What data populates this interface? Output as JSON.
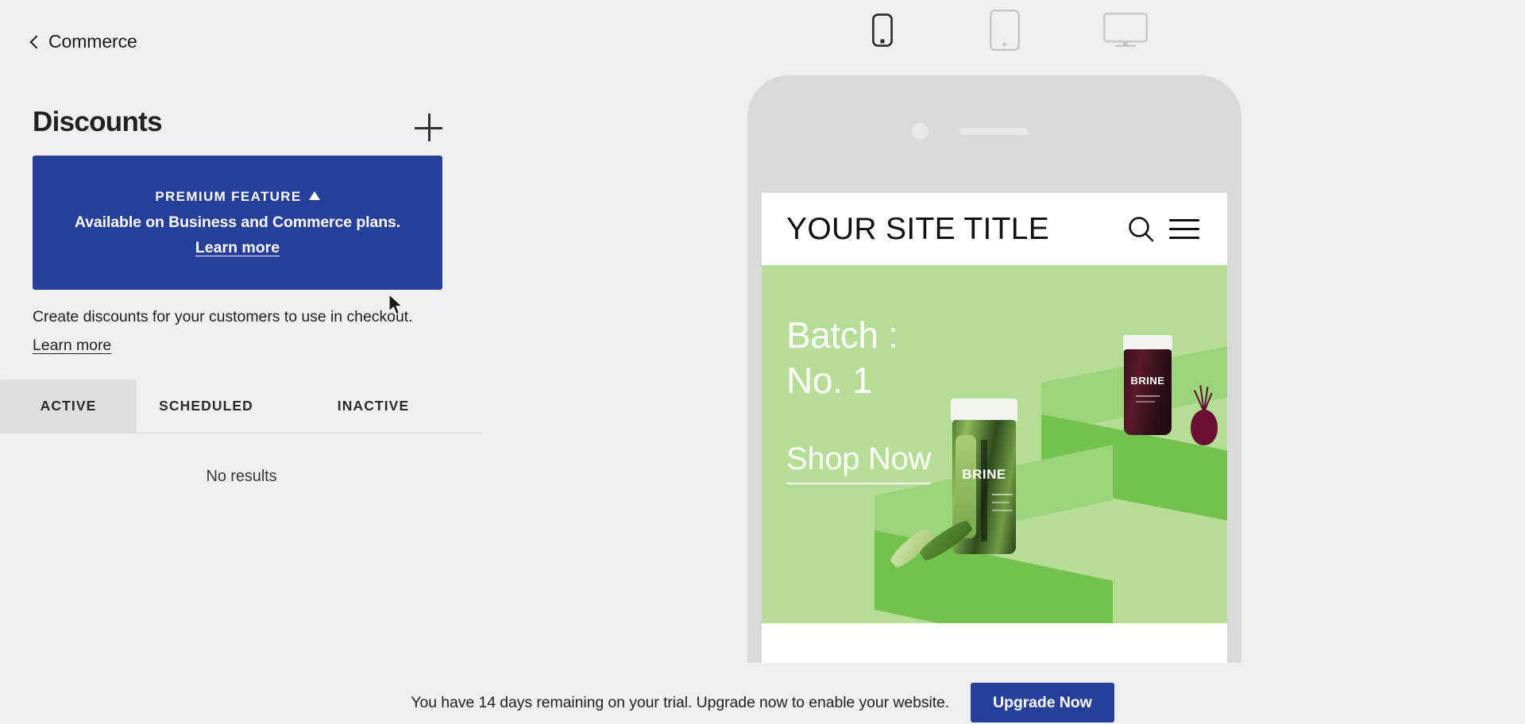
{
  "breadcrumb": {
    "label": "Commerce",
    "icon": "chevron-left-icon"
  },
  "page": {
    "title": "Discounts",
    "add_icon": "plus-icon"
  },
  "premium_banner": {
    "heading": "PREMIUM FEATURE",
    "caret_icon": "caret-up-icon",
    "subtitle": "Available on Business and Commerce plans.",
    "link_label": "Learn more",
    "background_color": "#26409a",
    "text_color": "#ffffff"
  },
  "description": {
    "text": "Create discounts for your customers to use in checkout.",
    "link_label": "Learn more"
  },
  "tabs": [
    {
      "label": "ACTIVE",
      "active": true
    },
    {
      "label": "SCHEDULED",
      "active": false
    },
    {
      "label": "INACTIVE",
      "active": false
    }
  ],
  "empty_state": {
    "message": "No results"
  },
  "device_switcher": {
    "devices": [
      {
        "name": "mobile",
        "icon": "phone-icon",
        "selected": true
      },
      {
        "name": "tablet",
        "icon": "tablet-icon",
        "selected": false
      },
      {
        "name": "desktop",
        "icon": "monitor-icon",
        "selected": false
      }
    ],
    "selected_color": "#2b2b2b",
    "unselected_color": "#c4c4c4"
  },
  "preview": {
    "device": "mobile",
    "site": {
      "title": "YOUR SITE TITLE",
      "search_icon": "search-icon",
      "menu_icon": "hamburger-menu-icon",
      "hero": {
        "heading_line1": "Batch :",
        "heading_line2": "No. 1",
        "cta_label": "Shop Now",
        "background_color": "#b5dd96",
        "product_label": "BRINE"
      }
    }
  },
  "trial_bar": {
    "message": "You have 14 days remaining on your trial. Upgrade now to enable your website.",
    "button_label": "Upgrade Now",
    "button_color": "#26409a"
  }
}
